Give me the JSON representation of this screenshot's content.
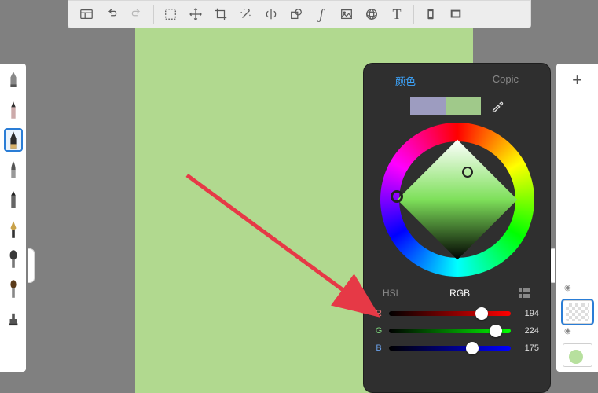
{
  "toolbar": {
    "items": [
      {
        "name": "panels-icon"
      },
      {
        "name": "undo-icon"
      },
      {
        "name": "redo-icon",
        "dim": true
      },
      {
        "name": "sep"
      },
      {
        "name": "marquee-icon"
      },
      {
        "name": "move-icon"
      },
      {
        "name": "crop-icon"
      },
      {
        "name": "magic-wand-icon"
      },
      {
        "name": "mirror-icon"
      },
      {
        "name": "shape-icon"
      },
      {
        "name": "curve-icon"
      },
      {
        "name": "image-icon"
      },
      {
        "name": "perspective-icon"
      },
      {
        "name": "text-icon",
        "glyph": "T"
      },
      {
        "name": "sep"
      },
      {
        "name": "device-icon"
      },
      {
        "name": "fullscreen-icon"
      }
    ]
  },
  "left_tools": [
    {
      "name": "eraser-tool"
    },
    {
      "name": "pencil-tool"
    },
    {
      "name": "pen-tool",
      "selected": true
    },
    {
      "name": "brush-tool"
    },
    {
      "name": "marker-tool"
    },
    {
      "name": "nib-tool"
    },
    {
      "name": "fat-brush-tool"
    },
    {
      "name": "round-brush-tool"
    },
    {
      "name": "stamp-tool"
    }
  ],
  "layers": {
    "add_glyph": "+",
    "items": [
      {
        "name": "layer-thumb-1",
        "kind": "checker",
        "visible": true,
        "active": true
      },
      {
        "name": "layer-thumb-2",
        "kind": "dot",
        "visible": true,
        "active": false
      }
    ]
  },
  "color_panel": {
    "tabs": {
      "color": "颜色",
      "copic": "Copic",
      "active": "color"
    },
    "swatch": {
      "a": "#9d9cc0",
      "b": "#a0c98a"
    },
    "modes": {
      "hsl": "HSL",
      "rgb": "RGB",
      "active": "rgb"
    },
    "sliders": {
      "r": {
        "label": "R",
        "value": 194,
        "max": 255
      },
      "g": {
        "label": "G",
        "value": 224,
        "max": 255
      },
      "b": {
        "label": "B",
        "value": 175,
        "max": 255
      }
    }
  },
  "arrow": {
    "color": "#e63946"
  }
}
